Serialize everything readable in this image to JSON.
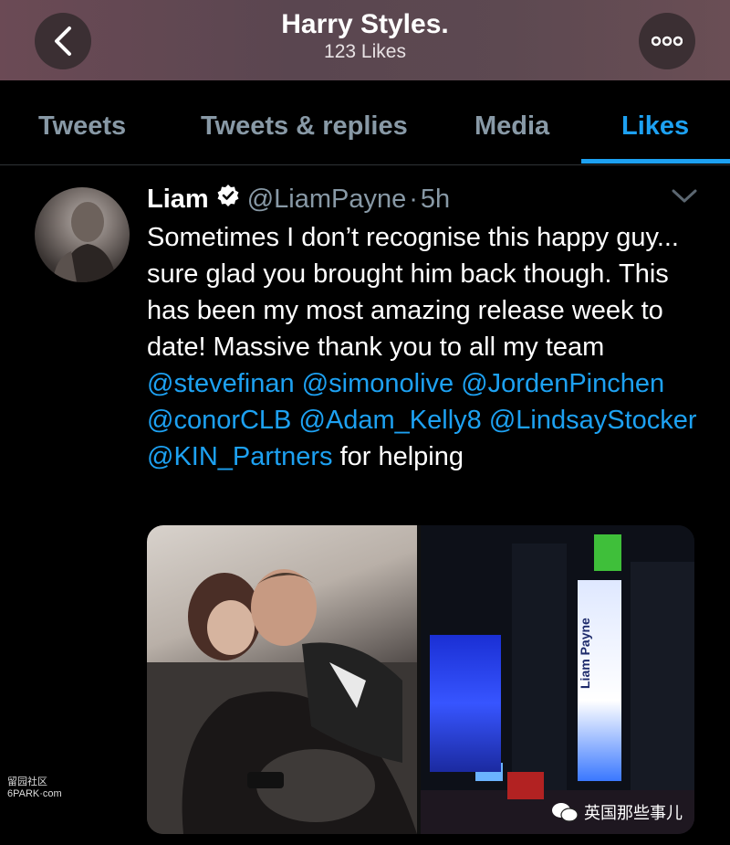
{
  "header": {
    "title": "Harry Styles.",
    "subtitle": "123 Likes"
  },
  "tabs": [
    {
      "label": "Tweets"
    },
    {
      "label": "Tweets & replies"
    },
    {
      "label": "Media"
    },
    {
      "label": "Likes"
    }
  ],
  "active_tab": "Likes",
  "tweet": {
    "name": "Liam",
    "handle": "@LiamPayne",
    "separator": "·",
    "time": "5h",
    "text_part1": "Sometimes I don’t recognise this happy guy... sure glad you brought him back though.  This has been my most amazing release week to date! Massive thank you to all my team ",
    "mentions": [
      "@stevefinan",
      "@simonolive",
      "@JordenPinchen",
      "@conorCLB",
      "@Adam_Kelly8",
      "@LindsayStocker",
      "@KIN_Partners"
    ],
    "text_end": " for helping"
  },
  "billboard_text": "Liam Payne",
  "watermarks": {
    "left_line1": "留园社区",
    "left_line2": "6PARK·com",
    "right": "英国那些事儿"
  },
  "colors": {
    "accent": "#1da1f2",
    "secondary_text": "#8899a6",
    "background": "#000000"
  },
  "icons": [
    "back-arrow-icon",
    "more-options-icon",
    "verified-badge-icon",
    "chevron-down-icon",
    "wechat-icon"
  ]
}
